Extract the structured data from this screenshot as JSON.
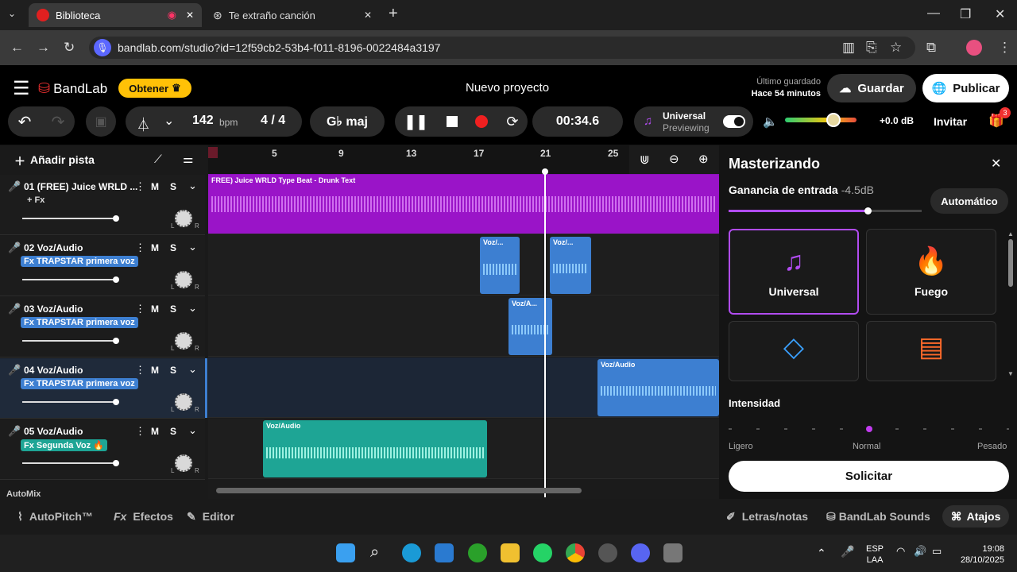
{
  "browser": {
    "tabs": [
      {
        "title": "Biblioteca",
        "active": true
      },
      {
        "title": "Te extraño canción",
        "active": false
      }
    ],
    "url": "bandlab.com/studio?id=12f59cb2-53b4-f011-8196-0022484a3197",
    "new_tab": "+",
    "minimize": "—",
    "restore": "❐",
    "close": "✕"
  },
  "app": {
    "menu": "☰",
    "brand": "BandLab",
    "obtener": "Obtener",
    "title": "Nuevo proyecto",
    "saved_line1": "Último guardado",
    "saved_line2": "Hace 54 minutos",
    "save": "Guardar",
    "publish": "Publicar"
  },
  "transport": {
    "bpm": "142",
    "bpm_unit": "bpm",
    "time_sig": "4 / 4",
    "key": "G♭ maj",
    "time": "00:34.6",
    "preset_name": "Universal",
    "preset_state": "Previewing",
    "volume": "+0.0 dB",
    "invite": "Invitar",
    "badge": "3"
  },
  "track_tools": {
    "add_track": "Añadir pista"
  },
  "ruler": [
    "5",
    "9",
    "13",
    "17",
    "21",
    "25"
  ],
  "tracks": [
    {
      "name": "01  (FREE) Juice WRLD ...",
      "fx": "+ Fx",
      "m": "M",
      "s": "S"
    },
    {
      "name": "02  Voz/Audio",
      "fx": "Fx  TRAPSTAR primera voz",
      "m": "M",
      "s": "S"
    },
    {
      "name": "03  Voz/Audio",
      "fx": "Fx  TRAPSTAR primera voz",
      "m": "M",
      "s": "S"
    },
    {
      "name": "04  Voz/Audio",
      "fx": "Fx  TRAPSTAR primera voz",
      "m": "M",
      "s": "S"
    },
    {
      "name": "05  Voz/Audio",
      "fx": "Fx  Segunda Voz 🔥",
      "m": "M",
      "s": "S"
    }
  ],
  "automix": "AutoMix",
  "clips": {
    "beat": "FREE) Juice WRLD Type Beat - Drunk Text",
    "c1": "Voz/...",
    "c2": "Voz/...",
    "c3": "Voz/A...",
    "c4": "Voz/Audio",
    "c5": "Voz/Audio"
  },
  "master": {
    "title": "Masterizando",
    "gain_label": "Ganancia de entrada",
    "gain_value": "-4.5dB",
    "auto": "Automático",
    "gain_level": 0.72,
    "presets": [
      {
        "name": "Universal",
        "icon": "music-note-icon",
        "color": "#b14cf0"
      },
      {
        "name": "Fuego",
        "icon": "flame-icon",
        "color": "#ff5a3c"
      },
      {
        "name": "",
        "icon": "diamond-icon",
        "color": "#3aa0ff"
      },
      {
        "name": "",
        "icon": "cassette-icon",
        "color": "#ff6a2a"
      }
    ],
    "intensity": "Intensidad",
    "light": "Ligero",
    "normal": "Normal",
    "heavy": "Pesado",
    "request": "Solicitar"
  },
  "bottom": {
    "autopitch": "AutoPitch™",
    "effects": "Efectos",
    "editor": "Editor",
    "lyrics": "Letras/notas",
    "sounds": "BandLab Sounds",
    "shortcuts": "Atajos"
  },
  "taskbar": {
    "lang1": "ESP",
    "lang2": "LAA",
    "time": "19:08",
    "date": "28/10/2025"
  },
  "colors": {
    "purple": "#9a14c8",
    "blue": "#3d7fd1",
    "teal": "#1ea595",
    "accent": "#ffc107"
  }
}
